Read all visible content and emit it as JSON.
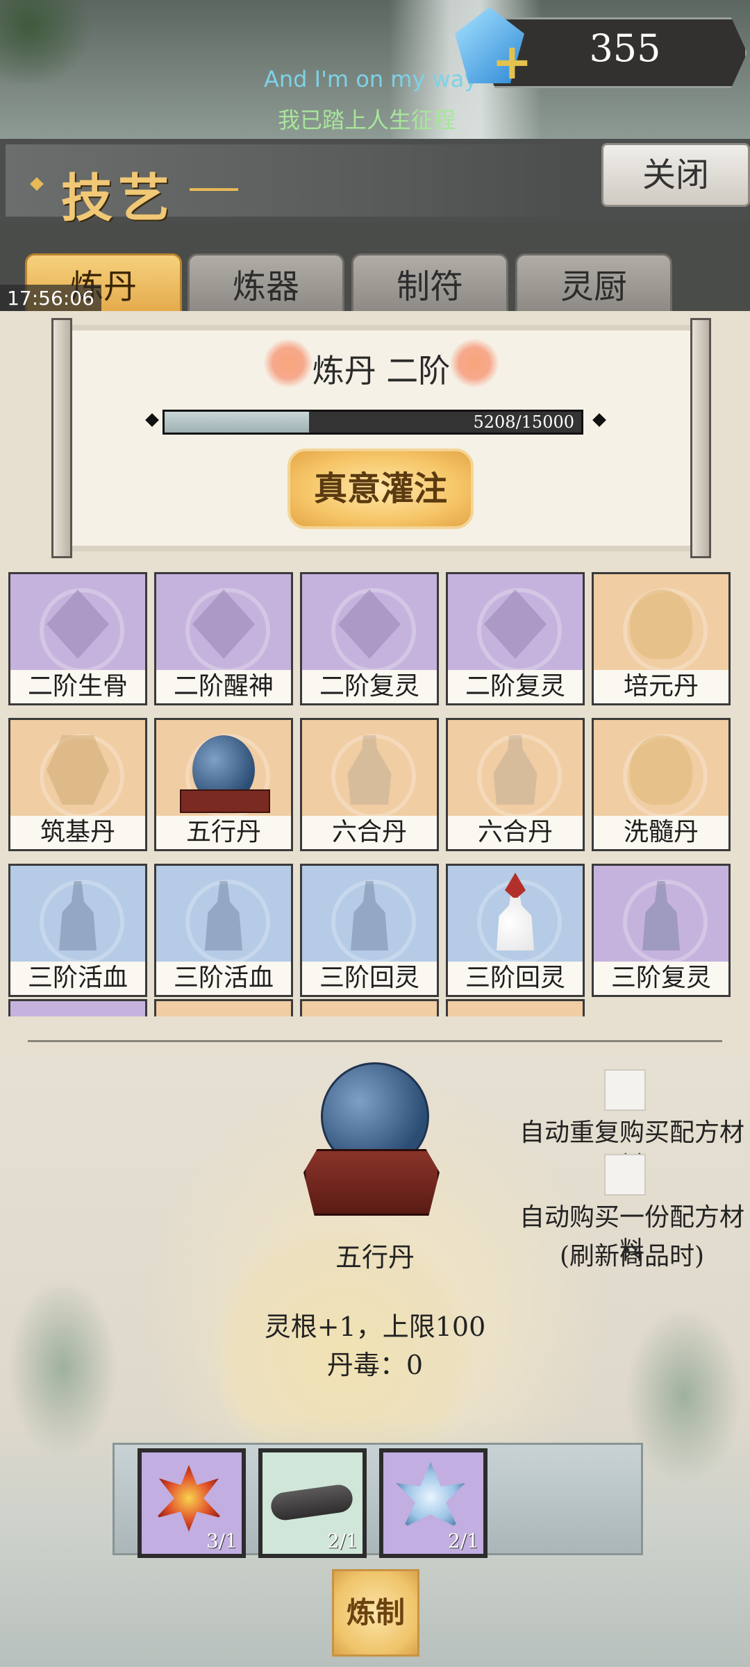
{
  "top": {
    "lyric_en": "And I'm on my way",
    "lyric_cn": "我已踏上人生征程",
    "currency_amount": "355",
    "currency_icon": "blue-gem-icon"
  },
  "header": {
    "title": "技艺",
    "close_label": "关闭"
  },
  "status": {
    "clock": "17:56:06"
  },
  "tabs": [
    {
      "label": "炼丹",
      "active": true
    },
    {
      "label": "炼器",
      "active": false
    },
    {
      "label": "制符",
      "active": false
    },
    {
      "label": "灵厨",
      "active": false
    }
  ],
  "rank": {
    "title": "炼丹 二阶",
    "progress_text": "5208/15000",
    "progress_value": 5208,
    "progress_max": 15000,
    "infuse_label": "真意灌注"
  },
  "recipes": [
    {
      "name": "二阶生骨",
      "theme": "purple",
      "shape": "cushion"
    },
    {
      "name": "二阶醒神",
      "theme": "purple",
      "shape": "cushion"
    },
    {
      "name": "二阶复灵",
      "theme": "purple",
      "shape": "cushion"
    },
    {
      "name": "二阶复灵",
      "theme": "purple",
      "shape": "cushion"
    },
    {
      "name": "培元丹",
      "theme": "orange",
      "shape": "orb"
    },
    {
      "name": "筑基丹",
      "theme": "orange",
      "shape": "box"
    },
    {
      "name": "五行丹",
      "theme": "orange",
      "shape": "ball"
    },
    {
      "name": "六合丹",
      "theme": "orange",
      "shape": "vase"
    },
    {
      "name": "六合丹",
      "theme": "orange",
      "shape": "vase"
    },
    {
      "name": "洗髓丹",
      "theme": "orange",
      "shape": "orb"
    },
    {
      "name": "三阶活血",
      "theme": "blue",
      "shape": "gourd"
    },
    {
      "name": "三阶活血",
      "theme": "blue",
      "shape": "gourd"
    },
    {
      "name": "三阶回灵",
      "theme": "blue",
      "shape": "gourd"
    },
    {
      "name": "三阶回灵",
      "theme": "blue",
      "shape": "whitegourd"
    },
    {
      "name": "三阶复灵",
      "theme": "purple",
      "shape": "gourd"
    }
  ],
  "detail": {
    "item_name": "五行丹",
    "effect": "灵根+1，上限100",
    "toxicity": "丹毒：0",
    "option1_label": "自动重复购买配方材料",
    "option2_label": "自动购买一份配方材料",
    "option2_note": "(刷新商品时)",
    "option1_checked": false,
    "option2_checked": false
  },
  "materials": [
    {
      "count": "3/1",
      "theme": "purple",
      "icon": "red-flame-flower-icon"
    },
    {
      "count": "2/1",
      "theme": "green",
      "icon": "charred-log-icon"
    },
    {
      "count": "2/1",
      "theme": "purple",
      "icon": "blue-lotus-icon"
    }
  ],
  "craft_label": "炼制"
}
